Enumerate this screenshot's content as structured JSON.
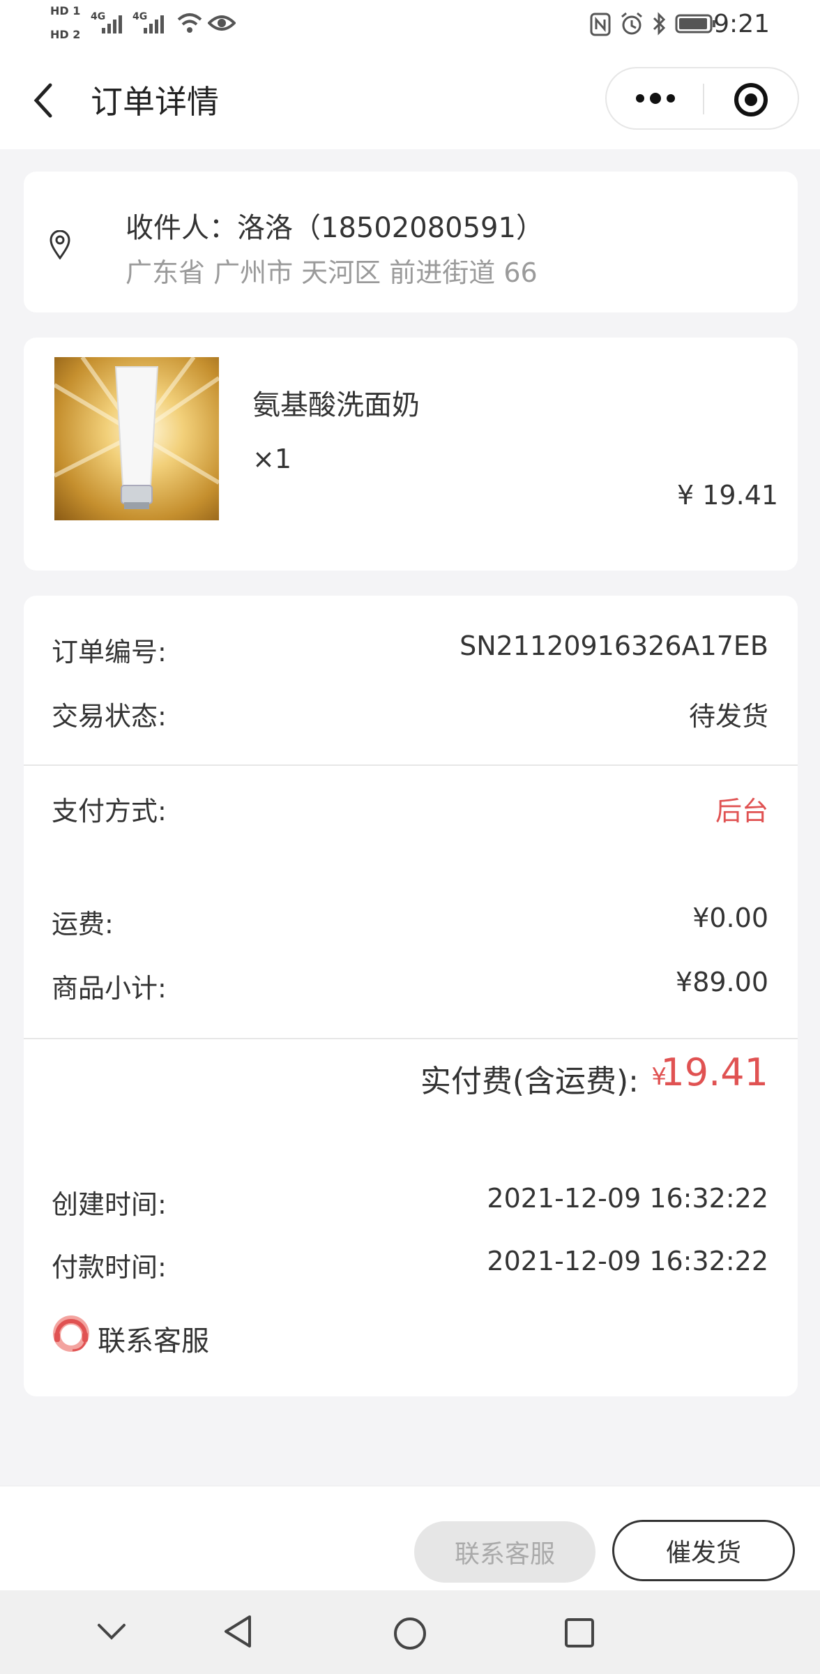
{
  "status_bar": {
    "hd1": "HD 1",
    "hd2": "HD 2",
    "net1": "4G",
    "net2": "4G",
    "time": "9:21"
  },
  "nav": {
    "title": "订单详情"
  },
  "address": {
    "recipient": "收件人：洛洛（18502080591）",
    "location": "广东省 广州市 天河区 前进街道 66"
  },
  "product": {
    "name": "氨基酸洗面奶",
    "quantity": "×1",
    "price": "¥ 19.41"
  },
  "order": {
    "number_label": "订单编号:",
    "number_value": "SN21120916326A17EB",
    "status_label": "交易状态:",
    "status_value": "待发货",
    "payment_label": "支付方式:",
    "payment_value": "后台",
    "shipping_label": "运费:",
    "shipping_value": "¥0.00",
    "subtotal_label": "商品小计:",
    "subtotal_value": "¥89.00",
    "total_label": "实付费(含运费):",
    "total_currency": "¥",
    "total_value": "19.41",
    "created_label": "创建时间:",
    "created_value": "2021-12-09 16:32:22",
    "paid_label": "付款时间:",
    "paid_value": "2021-12-09 16:32:22",
    "customer_service": "联系客服"
  },
  "actions": {
    "contact_label": "联系客服",
    "urge_label": "催发货"
  },
  "colors": {
    "accent_red": "#e05252",
    "background": "#f4f4f6"
  }
}
